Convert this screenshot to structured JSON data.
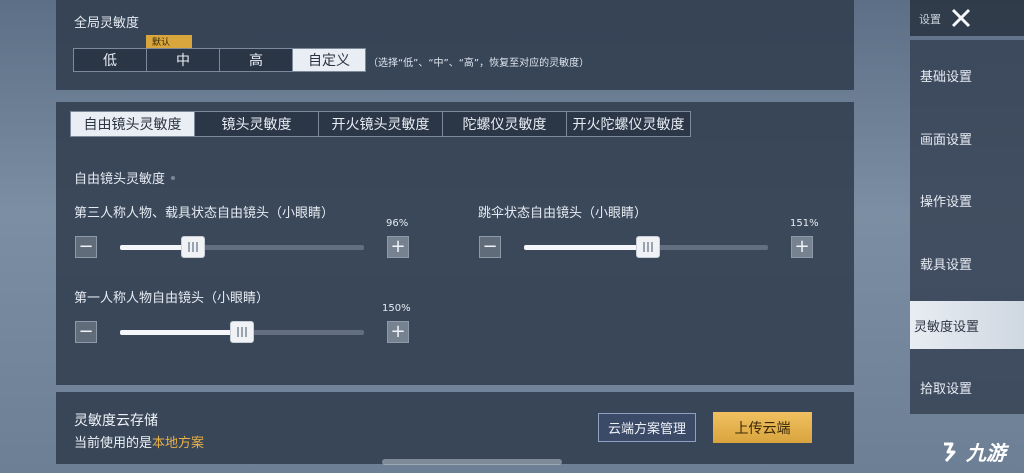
{
  "global": {
    "title": "全局灵敏度",
    "presets": [
      "低",
      "中",
      "高",
      "自定义"
    ],
    "active_preset": "自定义",
    "default_tag": "默认",
    "hint": "（选择“低”、“中”、“高”，恢复至对应的灵敏度）"
  },
  "tabs": [
    "自由镜头灵敏度",
    "镜头灵敏度",
    "开火镜头灵敏度",
    "陀螺仪灵敏度",
    "开火陀螺仪灵敏度"
  ],
  "active_tab": "自由镜头灵敏度",
  "section": {
    "title": "自由镜头灵敏度",
    "sliders": [
      {
        "label": "第三人称人物、载具状态自由镜头（小眼睛）",
        "value_text": "96%",
        "value": 0.3
      },
      {
        "label": "跳伞状态自由镜头（小眼睛）",
        "value_text": "151%",
        "value": 0.51
      },
      {
        "label": "第一人称人物自由镜头（小眼睛）",
        "value_text": "150%",
        "value": 0.5
      }
    ]
  },
  "cloud": {
    "title": "灵敏度云存储",
    "current_prefix": "当前使用的是",
    "current_value": "本地方案",
    "manage_button": "云端方案管理",
    "upload_button": "上传云端"
  },
  "sidebar": {
    "settings_label": "设置",
    "items": [
      "基础设置",
      "画面设置",
      "操作设置",
      "载具设置",
      "灵敏度设置",
      "拾取设置"
    ],
    "active": "灵敏度设置"
  },
  "watermark": "九游",
  "colors": {
    "accent": "#d9a43e",
    "highlight_text": "#e6b04a",
    "active_tab_bg": "#e9eef4"
  }
}
